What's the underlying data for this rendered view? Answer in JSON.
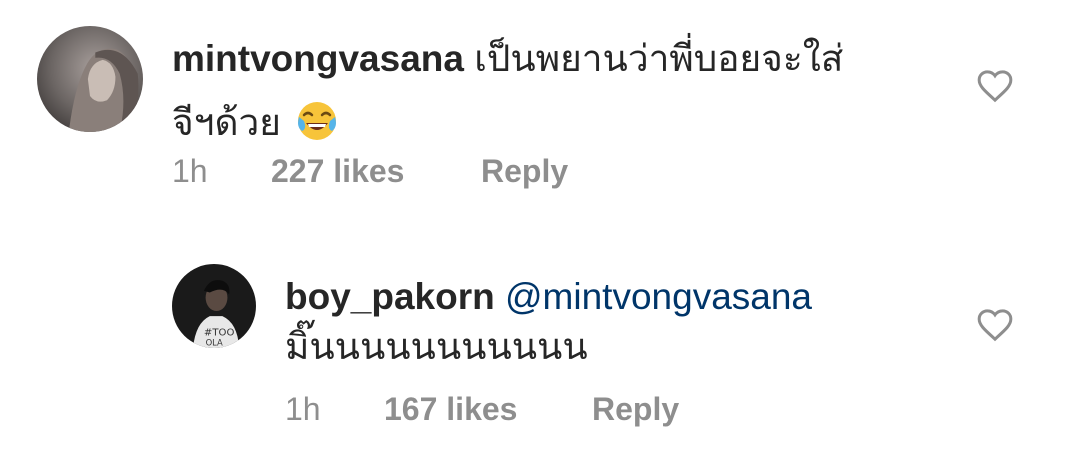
{
  "comments": [
    {
      "username": "mintvongvasana",
      "text_line1": "เป็นพยานว่าพี่บอยจะใส่",
      "text_line2": "จีฯด้วย",
      "emoji_icon": "face-with-tears-of-joy-icon",
      "time": "1h",
      "likes": "227 likes",
      "reply": "Reply"
    },
    {
      "username": "boy_pakorn",
      "mention": "@mintvongvasana",
      "text_line2": "มิ๊นนนนนนนนนนน",
      "time": "1h",
      "likes": "167 likes",
      "reply": "Reply"
    }
  ],
  "colors": {
    "text": "#262626",
    "meta": "#8e8e8e",
    "mention": "#003569",
    "heart_stroke": "#8e8e8e"
  }
}
